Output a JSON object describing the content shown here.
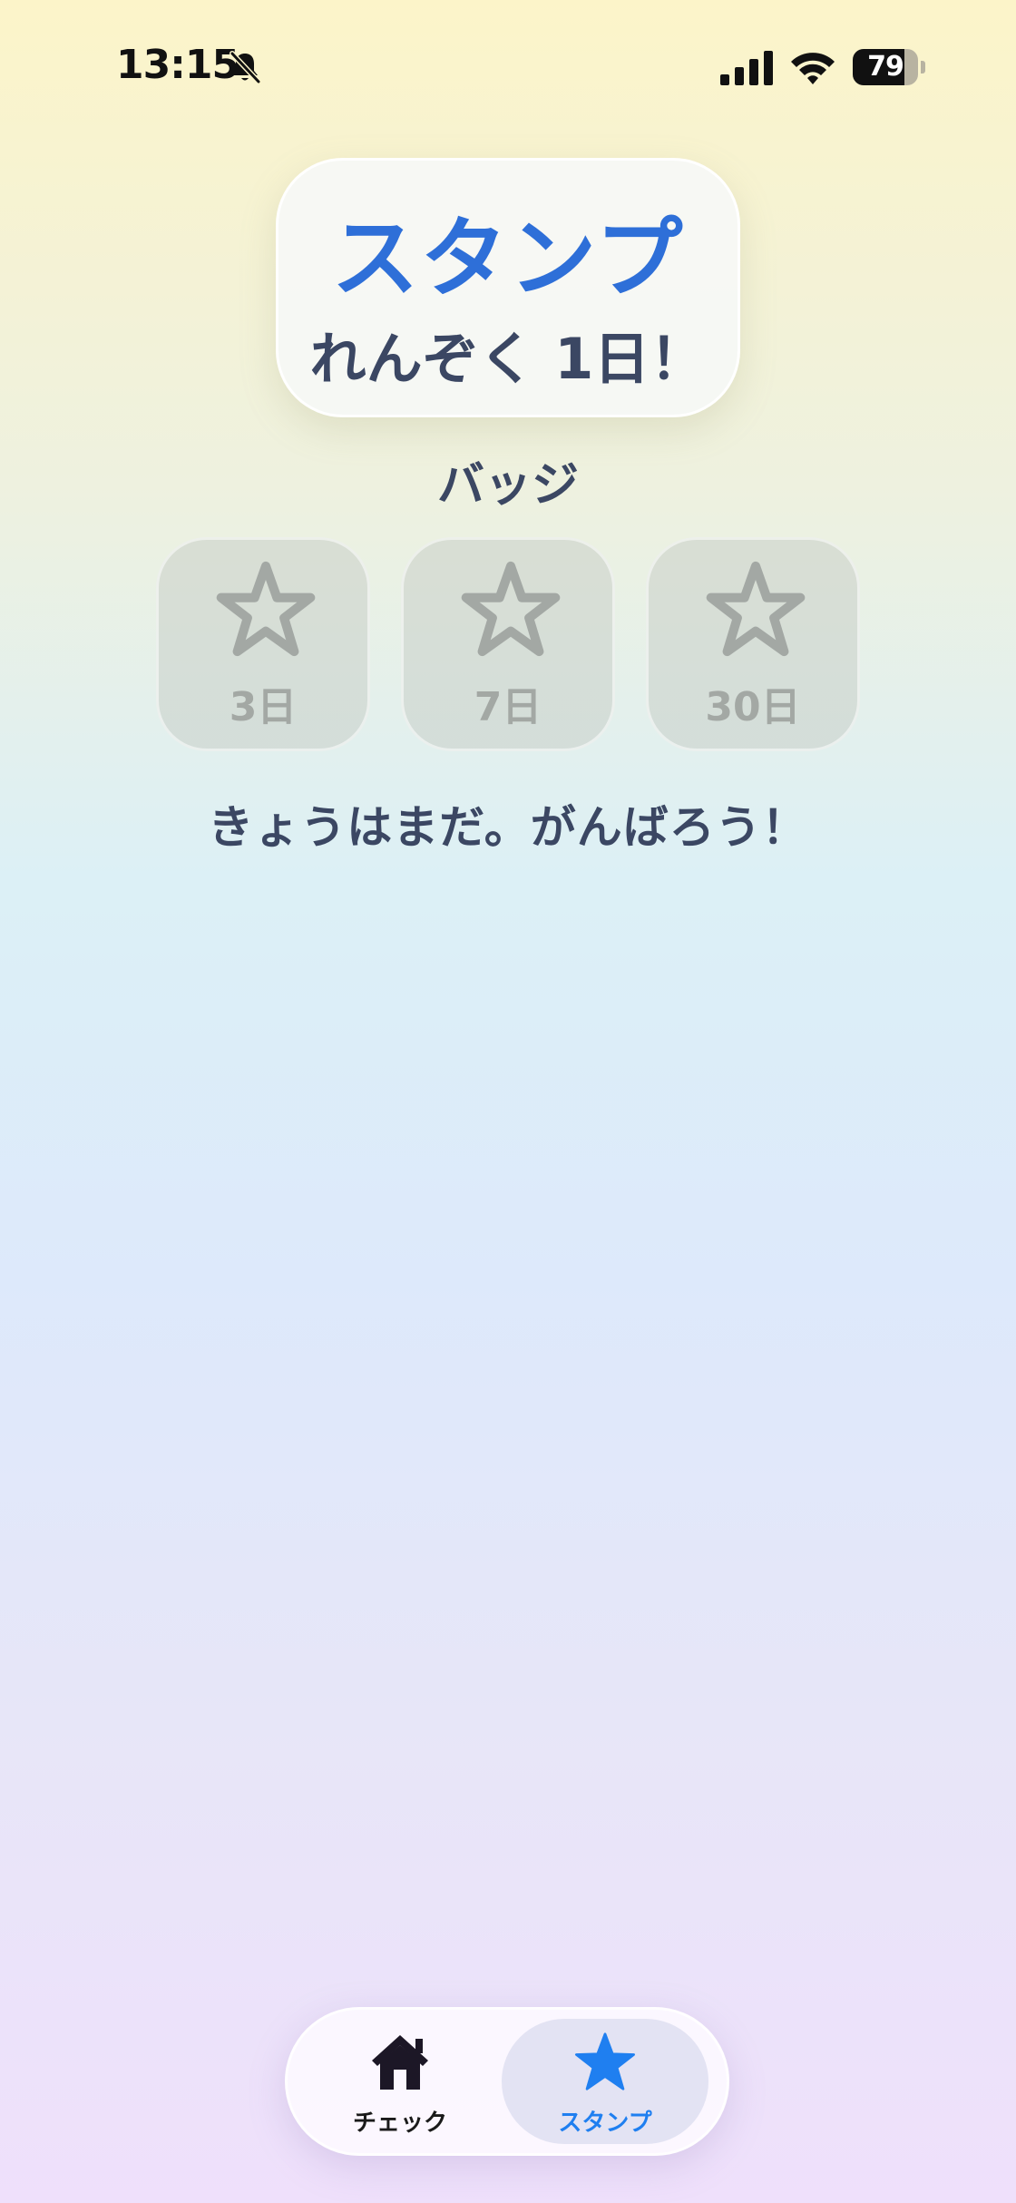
{
  "status_bar": {
    "time": "13:15",
    "battery_percent": "79",
    "battery_level": 0.79,
    "icons": [
      "bell-slash-icon",
      "cellular-signal-icon",
      "wifi-icon",
      "battery-icon"
    ]
  },
  "header": {
    "title": "スタンプ",
    "streak": "れんぞく 1日！"
  },
  "badges": {
    "label": "バッジ",
    "items": [
      {
        "label": "3日",
        "icon": "star-outline-icon",
        "earned": false
      },
      {
        "label": "7日",
        "icon": "star-outline-icon",
        "earned": false
      },
      {
        "label": "30日",
        "icon": "star-outline-icon",
        "earned": false
      }
    ]
  },
  "message": "きょうはまだ。がんばろう！",
  "tab_bar": {
    "tabs": [
      {
        "label": "チェック",
        "icon": "house-icon",
        "selected": false
      },
      {
        "label": "スタンプ",
        "icon": "star-filled-icon",
        "selected": true
      }
    ]
  },
  "colors": {
    "accent": "#2e6fd8",
    "tab_selected": "#1f7ff0",
    "text": "#3b4763",
    "badge_locked": "#a3a8a4"
  }
}
